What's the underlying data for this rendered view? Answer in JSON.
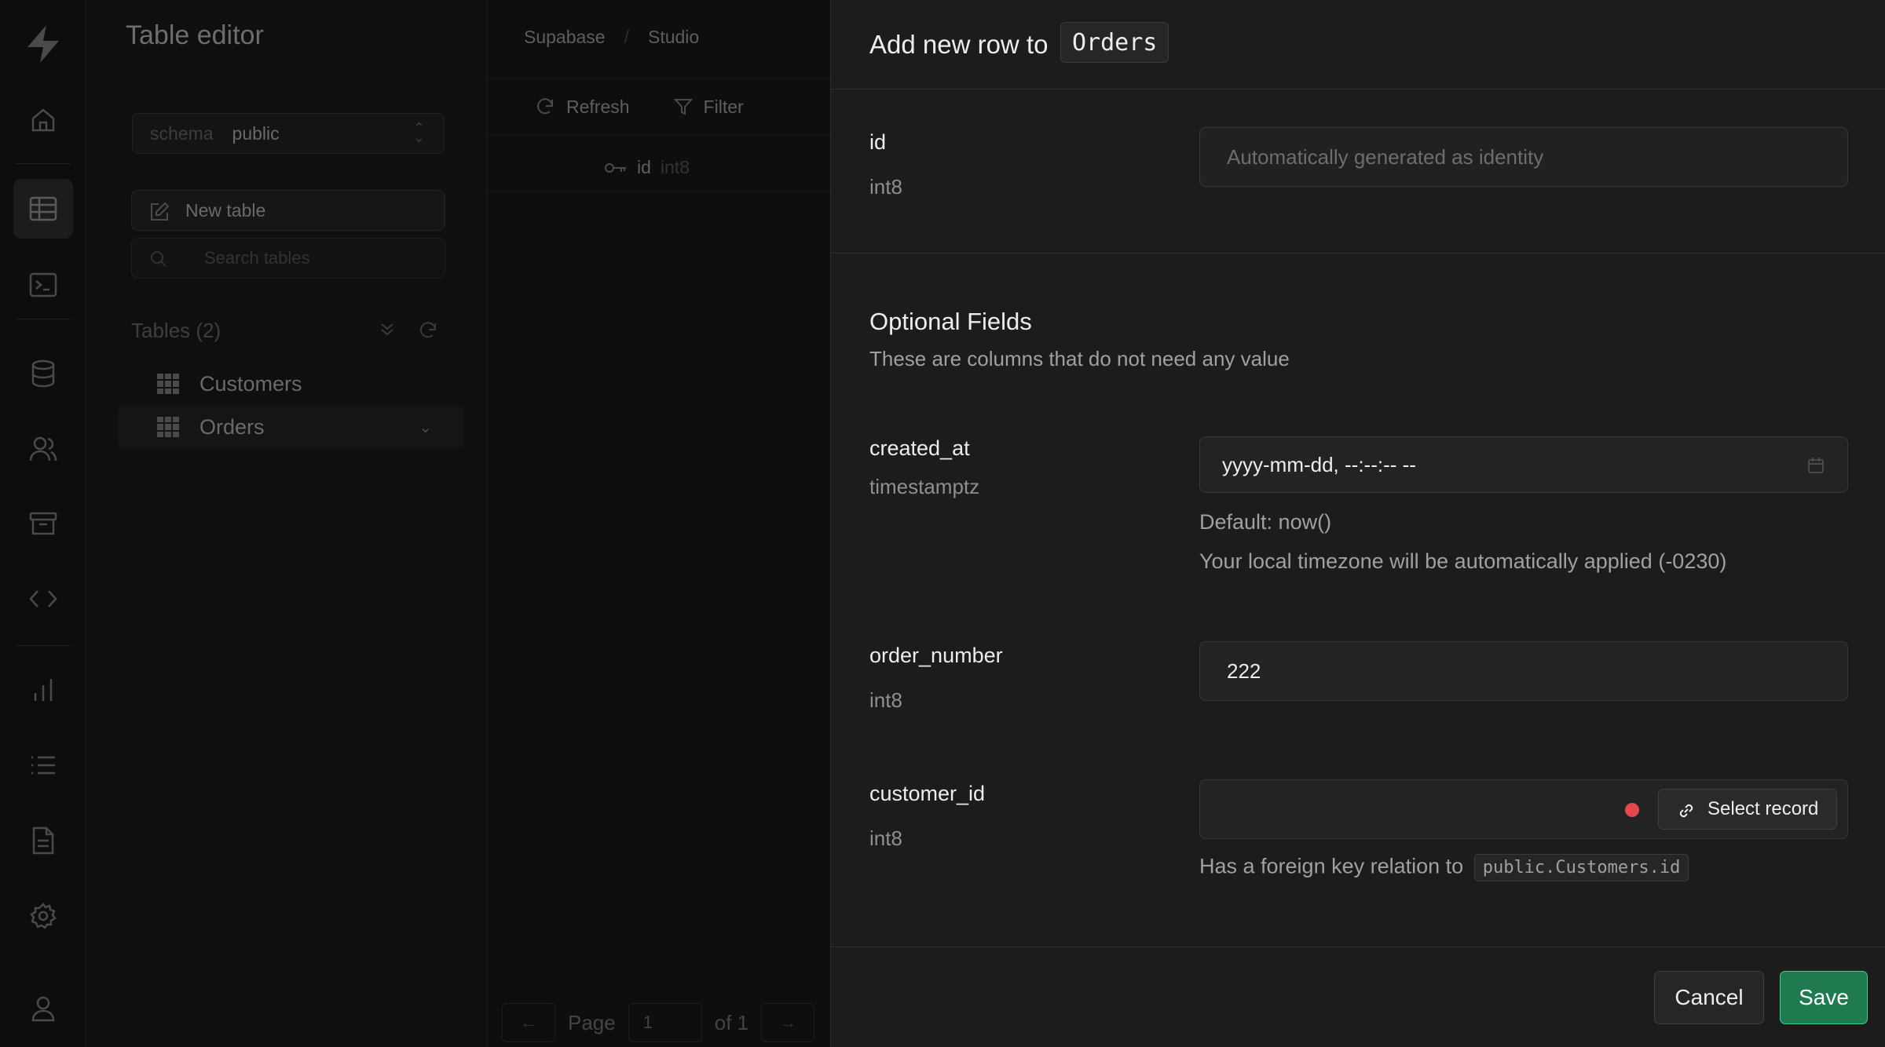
{
  "sidebar_left": {
    "icons": [
      "supabase-logo-icon",
      "home-icon",
      "table-editor-icon",
      "sql-editor-icon",
      "database-icon",
      "auth-users-icon",
      "storage-icon",
      "api-docs-icon",
      "reports-icon",
      "logs-icon",
      "docs-icon",
      "settings-icon",
      "account-icon"
    ]
  },
  "table_panel": {
    "title": "Table editor",
    "schema_label": "schema",
    "schema_value": "public",
    "new_table_label": "New table",
    "search_placeholder": "Search tables",
    "tables_heading": "Tables (2)",
    "tables": [
      {
        "label": "Customers"
      },
      {
        "label": "Orders"
      }
    ]
  },
  "grid": {
    "breadcrumb": [
      "Supabase",
      "Studio"
    ],
    "refresh_label": "Refresh",
    "filter_label": "Filter",
    "column_name": "id",
    "column_type": "int8",
    "page_label": "Page",
    "page_value": "1",
    "page_of": "of 1"
  },
  "drawer": {
    "title": "Add new row to",
    "table_name": "Orders",
    "id_field": {
      "name": "id",
      "type": "int8",
      "placeholder": "Automatically generated as identity"
    },
    "optional_title": "Optional Fields",
    "optional_desc": "These are columns that do not need any value",
    "created_at": {
      "name": "created_at",
      "type": "timestamptz",
      "value": "yyyy-mm-dd, --:--:-- --",
      "default_text": "Default: now()",
      "timezone_text": "Your local timezone will be automatically applied (-0230)"
    },
    "order_number": {
      "name": "order_number",
      "type": "int8",
      "value": "222"
    },
    "customer_id": {
      "name": "customer_id",
      "type": "int8",
      "value": "",
      "select_record_label": "Select record",
      "fk_text": "Has a foreign key relation to",
      "fk_target": "public.Customers.id"
    },
    "cancel_label": "Cancel",
    "save_label": "Save"
  },
  "colors": {
    "accent": "#3ecf8e",
    "save_bg": "#1f7a4f",
    "required_dot": "#e5484d",
    "drawer_bg": "#1c1c1c"
  }
}
